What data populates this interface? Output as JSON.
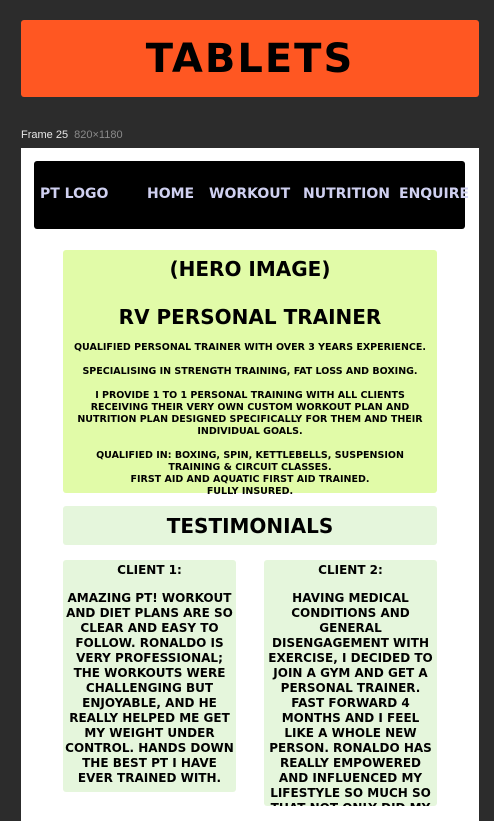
{
  "banner": {
    "title": "TABLETS"
  },
  "frame": {
    "name": "Frame 25",
    "size": "820×1180"
  },
  "nav": {
    "logo": "PT LOGO",
    "items": [
      "HOME",
      "WORKOUT",
      "NUTRITION",
      "ENQUIRE"
    ]
  },
  "hero": {
    "heading": "(HERO IMAGE)",
    "title": "RV PERSONAL TRAINER",
    "line1": "QUALIFIED PERSONAL TRAINER WITH OVER 3 YEARS EXPERIENCE.",
    "line2": "SPECIALISING IN STRENGTH TRAINING, FAT LOSS AND BOXING.",
    "line3": "I PROVIDE 1 TO 1 PERSONAL TRAINING WITH ALL CLIENTS RECEIVING THEIR VERY OWN CUSTOM WORKOUT PLAN AND NUTRITION PLAN DESIGNED SPECIFICALLY FOR THEM AND THEIR INDIVIDUAL GOALS.",
    "line4": "QUALIFIED IN: BOXING, SPIN, KETTLEBELLS, SUSPENSION TRAINING & CIRCUIT CLASSES.",
    "line5": "FIRST AID AND AQUATIC FIRST AID TRAINED.",
    "line6": "FULLY INSURED."
  },
  "testimonials": {
    "heading": "TESTIMONIALS",
    "clients": [
      {
        "title": "CLIENT 1:",
        "text": "AMAZING PT! WORKOUT AND DIET PLANS ARE SO CLEAR AND EASY TO FOLLOW. RONALDO IS VERY PROFESSIONAL; THE WORKOUTS WERE CHALLENGING BUT ENJOYABLE, AND HE REALLY HELPED ME GET MY WEIGHT UNDER CONTROL. HANDS DOWN THE BEST PT I HAVE EVER TRAINED WITH."
      },
      {
        "title": "CLIENT 2:",
        "text": "HAVING MEDICAL CONDITIONS AND GENERAL DISENGAGEMENT WITH EXERCISE, I DECIDED TO JOIN A GYM AND GET A PERSONAL TRAINER. FAST FORWARD 4 MONTHS AND I FEEL LIKE A WHOLE NEW PERSON. RONALDO HAS REALLY EMPOWERED AND INFLUENCED MY LIFESTYLE SO MUCH SO THAT NOT ONLY DID MY POSTURE AND"
      }
    ]
  },
  "colors": {
    "banner": "#ff5722",
    "nav_bg": "#000000",
    "nav_text": "#cfd0f0",
    "hero_bg": "#e1fba8",
    "card_bg": "#e5f6dc",
    "canvas": "#2c2c2c"
  }
}
